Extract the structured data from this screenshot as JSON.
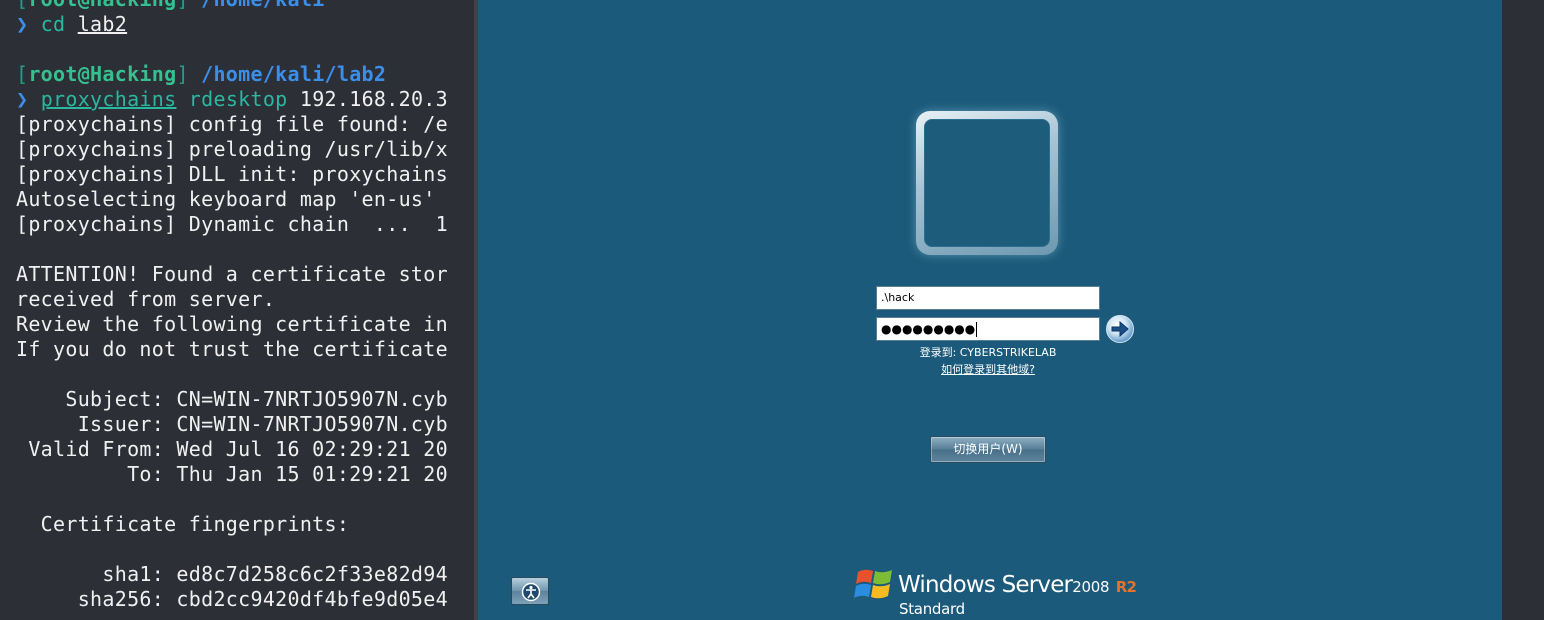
{
  "terminal": {
    "prompt1": {
      "open": "[",
      "user": "root@Hacking",
      "close": "]",
      "path": "/home/kali"
    },
    "cmd1": {
      "arrow": "❯",
      "cmd": "cd",
      "arg": "lab2"
    },
    "prompt2": {
      "open": "[",
      "user": "root@Hacking",
      "close": "]",
      "path": "/home/kali/lab2"
    },
    "cmd2": {
      "arrow": "❯",
      "cmd": "proxychains",
      "arg1": "rdesktop",
      "arg2": "192.168.20.3"
    },
    "out1": "[proxychains] config file found: /e",
    "out2": "[proxychains] preloading /usr/lib/x",
    "out3": "[proxychains] DLL init: proxychains",
    "out4": "Autoselecting keyboard map 'en-us'",
    "out5": "[proxychains] Dynamic chain  ...  1",
    "out6": "ATTENTION! Found a certificate stor",
    "out7": "received from server.",
    "out8": "Review the following certificate in",
    "out9": "If you do not trust the certificate",
    "cert_subject": "    Subject: CN=WIN-7NRTJO5907N.cyb",
    "cert_issuer": "     Issuer: CN=WIN-7NRTJO5907N.cyb",
    "cert_valid_from": " Valid From: Wed Jul 16 02:29:21 20",
    "cert_to": "         To: Thu Jan 15 01:29:21 20",
    "fp_header": "  Certificate fingerprints:",
    "fp_sha1": "       sha1: ed8c7d258c6c2f33e82d94",
    "fp_sha256": "     sha256: cbd2cc9420df4bfe9d05e4"
  },
  "login": {
    "username_value": ".\\hack",
    "password_mask": "●●●●●●●●●",
    "logon_to": "登录到: CYBERSTRIKELAB",
    "other_domain_link": "如何登录到其他域?",
    "switch_user_label": "切换用户(W)"
  },
  "branding": {
    "product": "Windows Server",
    "version": "2008",
    "release": "R2",
    "edition": "Standard"
  },
  "colors": {
    "rdp_background": "#1b5a7a",
    "terminal_background": "#2c2f36",
    "prompt_user": "#35c18f",
    "prompt_path": "#3b8eea",
    "r2_accent": "#e4722b"
  }
}
